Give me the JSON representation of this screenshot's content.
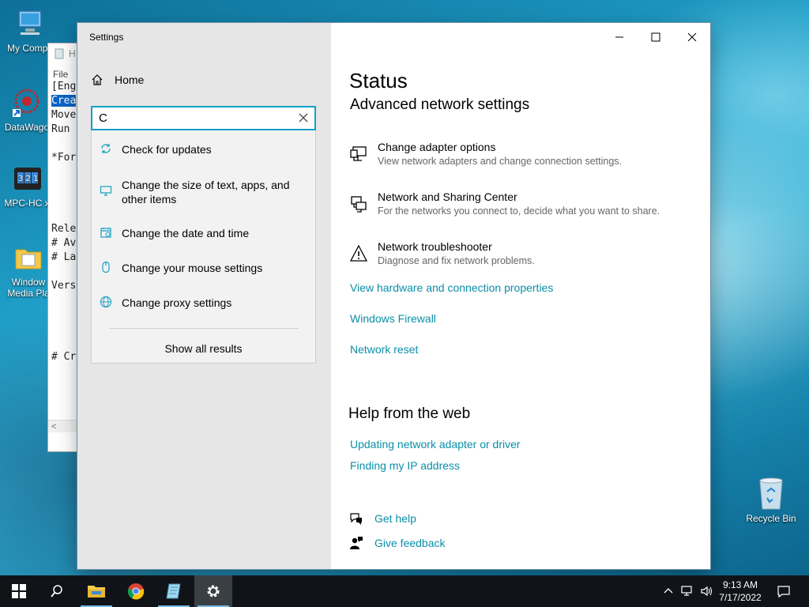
{
  "desktop": {
    "icons": [
      {
        "label": "My Compu"
      },
      {
        "label": "DataWago"
      },
      {
        "label": "MPC-HC x"
      },
      {
        "label": "Window",
        "label2": "Media Pla"
      }
    ],
    "recycle_bin": "Recycle Bin"
  },
  "notepad": {
    "title": "H",
    "menu": "File",
    "lines": [
      "[Eng",
      "Crea",
      "Move",
      "Run ",
      "",
      "*For",
      "",
      "",
      "",
      "",
      "Relea",
      "# Ava",
      "# Lat",
      "",
      "Versi",
      "",
      "",
      "",
      "",
      "# Cre"
    ],
    "scroll_arrow": "<"
  },
  "settings": {
    "window_title": "Settings",
    "home_label": "Home",
    "search": {
      "value": "C",
      "placeholder": ""
    },
    "suggestions": [
      {
        "label": "Check for updates",
        "icon": "sync-icon"
      },
      {
        "label": "Change the size of text, apps, and other items",
        "icon": "display-icon"
      },
      {
        "label": "Change the date and time",
        "icon": "calendar-icon"
      },
      {
        "label": "Change your mouse settings",
        "icon": "mouse-icon"
      },
      {
        "label": "Change proxy settings",
        "icon": "globe-icon"
      }
    ],
    "show_all": "Show all results",
    "page_heading": "Status",
    "section_heading": "Advanced network settings",
    "options": [
      {
        "title": "Change adapter options",
        "desc": "View network adapters and change connection settings.",
        "icon": "adapter-icon"
      },
      {
        "title": "Network and Sharing Center",
        "desc": "For the networks you connect to, decide what you want to share.",
        "icon": "sharing-icon"
      },
      {
        "title": "Network troubleshooter",
        "desc": "Diagnose and fix network problems.",
        "icon": "warning-icon"
      }
    ],
    "links": [
      "View hardware and connection properties",
      "Windows Firewall",
      "Network reset"
    ],
    "help_heading": "Help from the web",
    "help_links": [
      "Updating network adapter or driver",
      "Finding my IP address"
    ],
    "get_help": "Get help",
    "give_feedback": "Give feedback",
    "colors": {
      "accent": "#0a8fa8",
      "search_border": "#14a0c8",
      "left_pane": "#e6e6e6"
    }
  },
  "taskbar": {
    "time": "9:13 AM",
    "date": "7/17/2022"
  }
}
